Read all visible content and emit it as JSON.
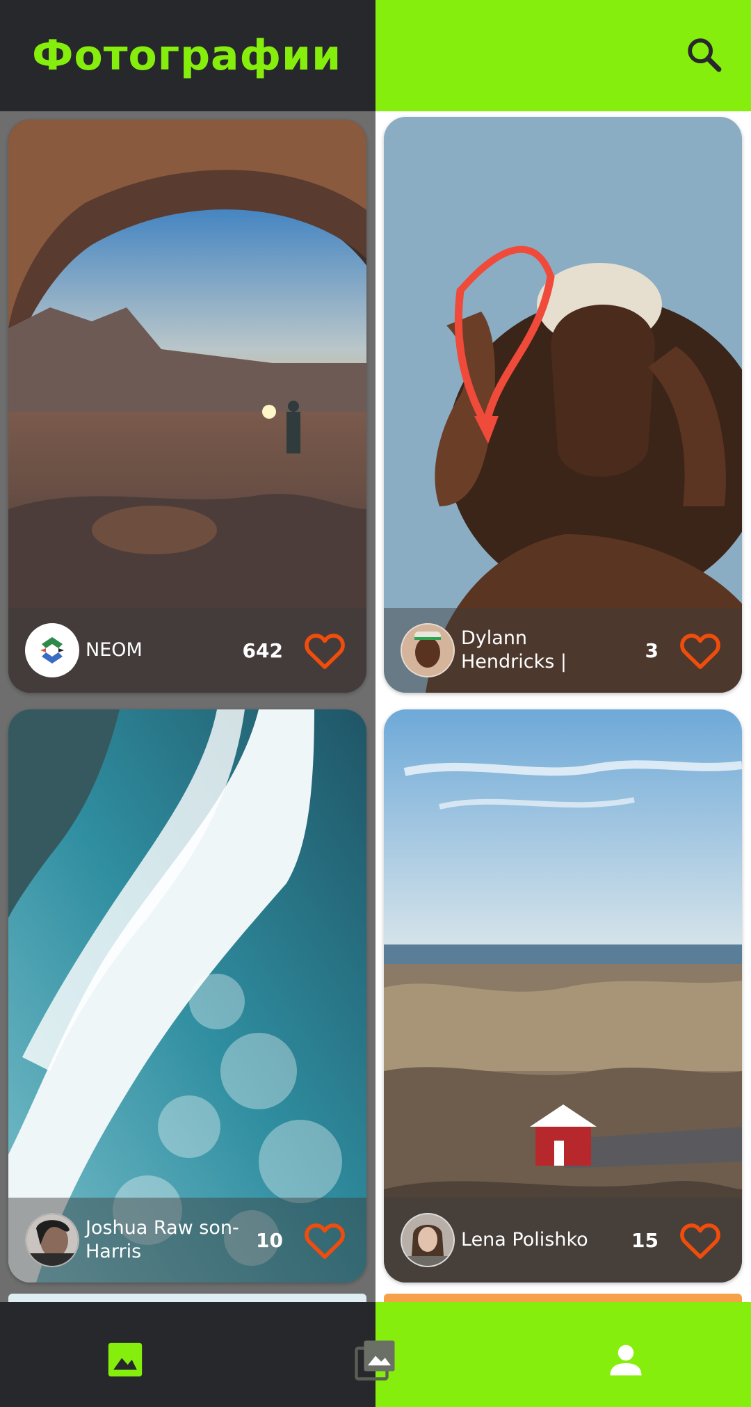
{
  "header": {
    "title": "Фотографии",
    "search_icon": "search-icon"
  },
  "colors": {
    "accent": "#86ee0c",
    "dark": "#27282c",
    "heart": "#f04d0c"
  },
  "photos": [
    {
      "author": "NEOM",
      "likes": "642",
      "avatar": "neom-logo",
      "scene": "desert-arch-sunset"
    },
    {
      "author": "Dylann Hendricks |",
      "likes": "3",
      "avatar": "person-portrait",
      "scene": "man-with-red-beads"
    },
    {
      "author": "Joshua Raw son-Harris",
      "likes": "10",
      "avatar": "person-portrait",
      "scene": "aerial-ocean-wave"
    },
    {
      "author": "Lena Polishko",
      "likes": "15",
      "avatar": "person-portrait",
      "scene": "rocky-coast-red-house"
    }
  ],
  "bottom_nav": {
    "items": [
      {
        "icon": "image-icon",
        "active": true
      },
      {
        "icon": "collections-icon",
        "active": false
      },
      {
        "icon": "profile-icon",
        "active": false
      }
    ]
  }
}
